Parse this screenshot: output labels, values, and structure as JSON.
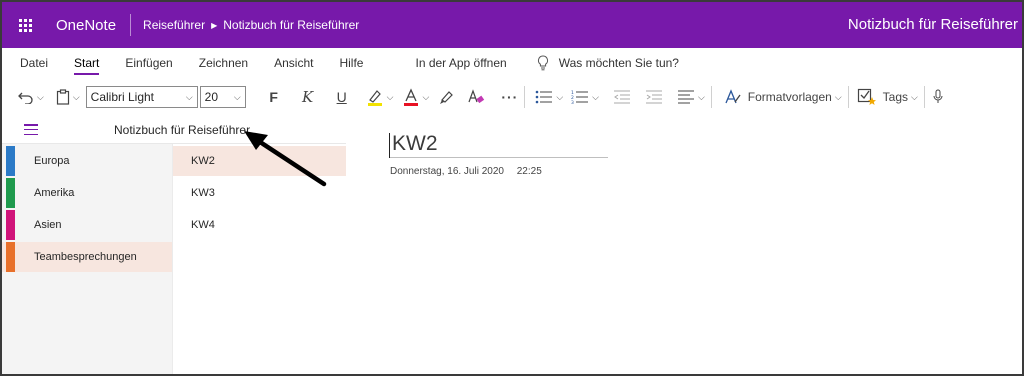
{
  "app": {
    "name": "OneNote",
    "breadcrumb": [
      "Reiseführer",
      "Notizbuch für Reiseführer"
    ],
    "title_right": "Notizbuch für Reiseführer",
    "brand_color": "#7719aa"
  },
  "menu": {
    "items": [
      "Datei",
      "Start",
      "Einfügen",
      "Zeichnen",
      "Ansicht",
      "Hilfe"
    ],
    "active": "Start",
    "open_in_app": "In der App öffnen",
    "tell_me": "Was möchten Sie tun?"
  },
  "ribbon": {
    "font_name": "Calibri Light",
    "font_size": "20",
    "bold": "F",
    "italic": "K",
    "underline": "U",
    "more": "···",
    "styles": "Formatvorlagen",
    "tags": "Tags",
    "icons": [
      "undo-icon",
      "clipboard-icon",
      "highlighter-icon",
      "font-color-icon",
      "format-painter-icon",
      "clear-format-icon",
      "bullets-icon",
      "numbering-icon",
      "outdent-icon",
      "indent-icon",
      "align-icon",
      "styles-icon",
      "tags-icon"
    ],
    "highlight_color": "#f2e200",
    "font_color": "#e81123"
  },
  "notebook": {
    "name": "Notizbuch für Reiseführer",
    "sections": [
      {
        "label": "Europa",
        "color": "#2b7ac7"
      },
      {
        "label": "Amerika",
        "color": "#1f9a4d"
      },
      {
        "label": "Asien",
        "color": "#d1147a"
      },
      {
        "label": "Teambesprechungen",
        "color": "#e8702a"
      }
    ],
    "active_section": "Teambesprechungen",
    "pages": [
      "KW2",
      "KW3",
      "KW4"
    ],
    "active_page": "KW2"
  },
  "page": {
    "title": "KW2",
    "date": "Donnerstag, 16. Juli 2020",
    "time": "22:25"
  }
}
